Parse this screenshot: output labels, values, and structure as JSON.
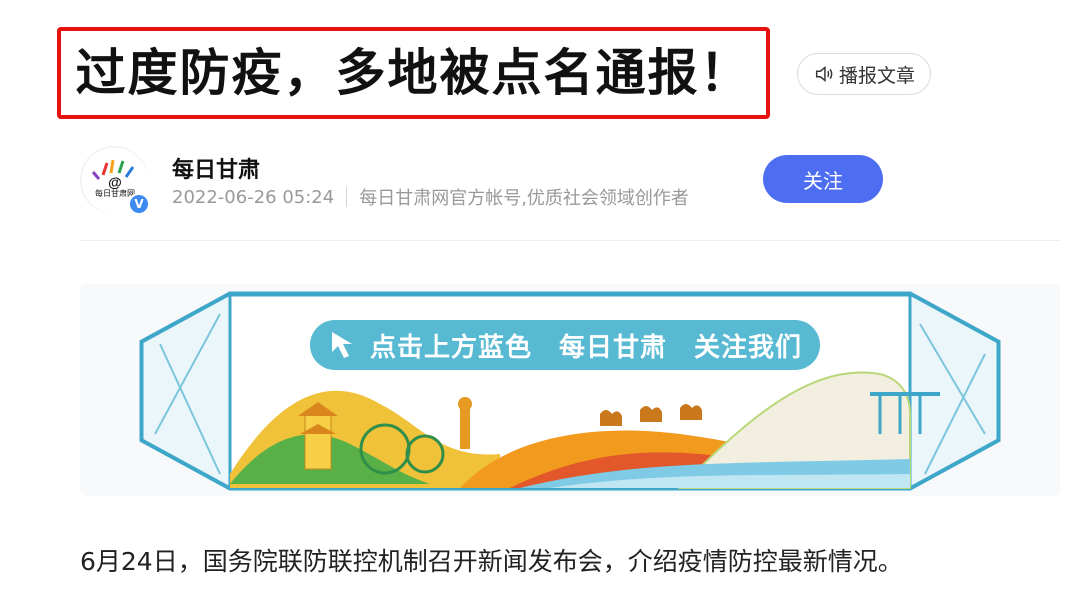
{
  "article": {
    "title": "过度防疫，多地被点名通报！",
    "read_aloud_label": "播报文章",
    "author": {
      "name": "每日甘肃",
      "date": "2022-06-26 05:24",
      "description": "每日甘肃网官方帐号,优质社会领域创作者",
      "avatar_text": "每日甘肃网",
      "verified": true
    },
    "follow_label": "关注",
    "banner": {
      "pill_text": "点击上方蓝色　每日甘肃　关注我们"
    },
    "first_paragraph": "6月24日，国务院联防联控机制召开新闻发布会，介绍疫情防控最新情况。"
  },
  "colors": {
    "title_border": "#e8100e",
    "follow_button": "#4e6ef2",
    "banner_frame": "#3ea6c9",
    "banner_pill": "#58b9d3"
  }
}
